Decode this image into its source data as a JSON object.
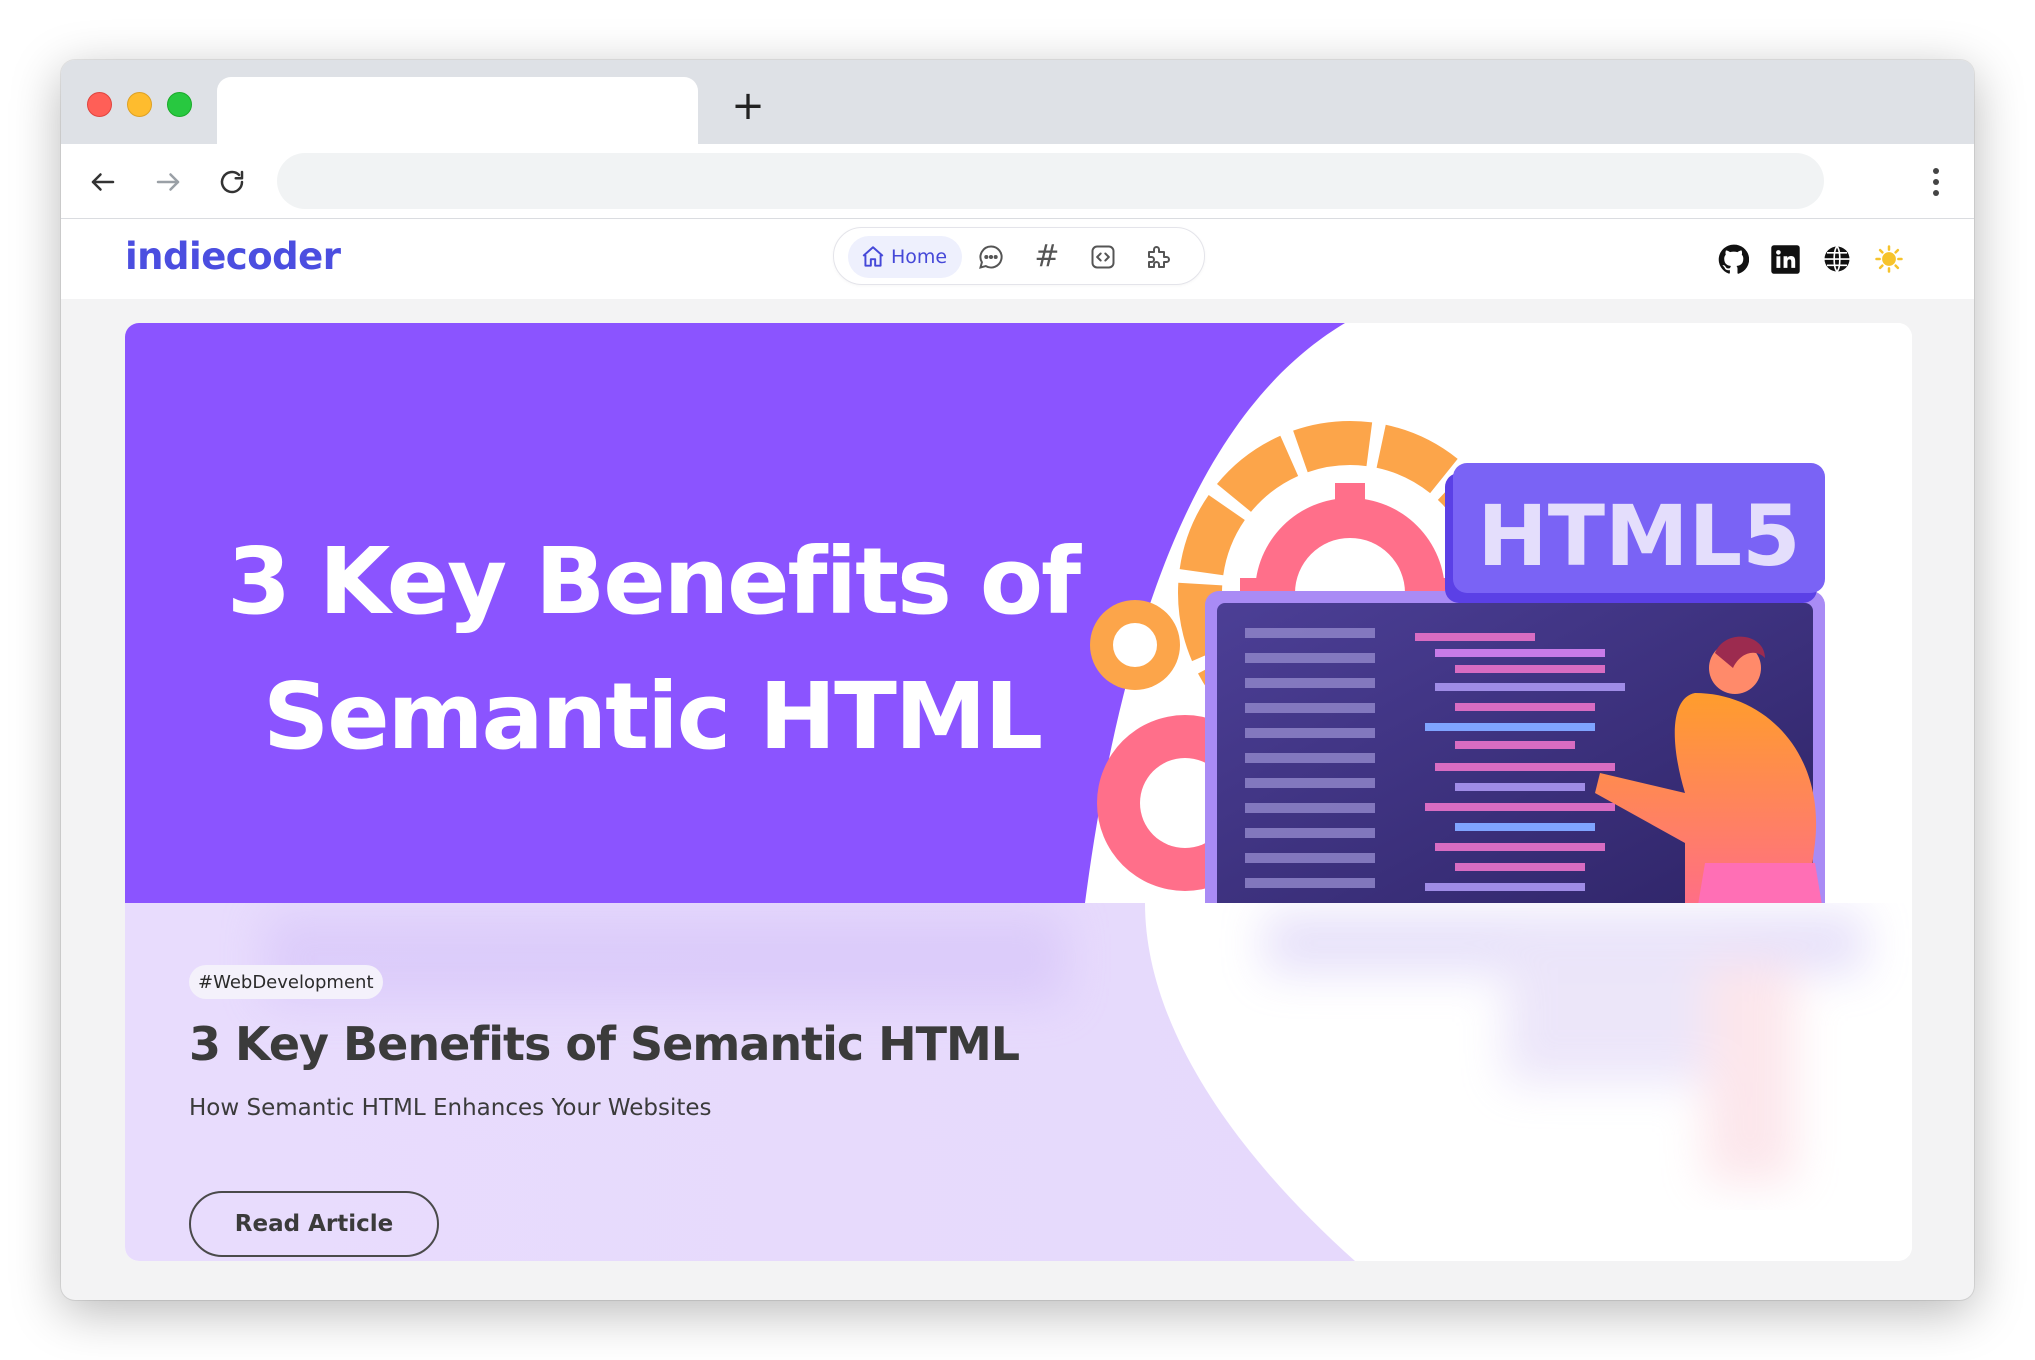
{
  "browser": {
    "tab_title": "",
    "new_tab_symbol": "+",
    "address": ""
  },
  "site": {
    "logo": "indiecoder",
    "nav": {
      "home_label": "Home",
      "hash_symbol": "#"
    },
    "social_icons": [
      "github-icon",
      "linkedin-icon",
      "globe-icon",
      "sun-icon"
    ]
  },
  "hero": {
    "banner_line1": "3 Key Benefits of",
    "banner_line2": "Semantic HTML",
    "banner_badge": "HTML5",
    "tag": "#WebDevelopment",
    "title": "3 Key Benefits of Semantic HTML",
    "subtitle": "How Semantic HTML Enhances Your Websites",
    "button_label": "Read Article"
  },
  "colors": {
    "brand": "#4b4ee0",
    "banner_purple": "#8b54ff",
    "content_lavender": "#e7dcfd",
    "sun_yellow": "#f6c32c"
  }
}
